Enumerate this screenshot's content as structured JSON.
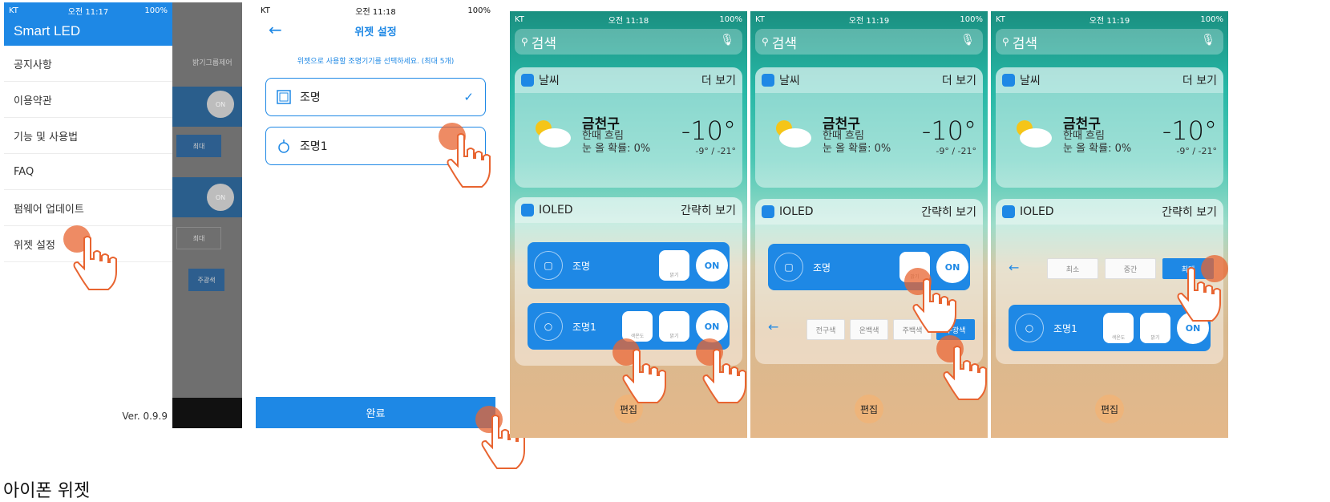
{
  "status_bar": {
    "p1": {
      "carrier": "KT",
      "time": "오전 11:17",
      "battery": "100%"
    },
    "p2": {
      "carrier": "KT",
      "time": "오전 11:18",
      "battery": "100%"
    },
    "p3": {
      "carrier": "KT",
      "time": "오전 11:18",
      "battery": "100%"
    },
    "p4": {
      "carrier": "KT",
      "time": "오전 11:19",
      "battery": "100%"
    },
    "p5": {
      "carrier": "KT",
      "time": "오전 11:19",
      "battery": "100%"
    }
  },
  "drawer": {
    "title": "Smart LED",
    "items": [
      "공지사항",
      "이용약관",
      "기능 및 사용법",
      "FAQ",
      "펌웨어 업데이트",
      "위젯 설정"
    ],
    "version": "Ver. 0.9.9",
    "bg_labels": {
      "top": "밝기그룹제어",
      "on1": "ON",
      "max": "최대",
      "on2": "ON",
      "max2": "최대",
      "main": "주광색"
    }
  },
  "widget_settings": {
    "back": "←",
    "title": "위젯 설정",
    "hint": "위젯으로 사용할 조명기기를 선택하세요. (최대 5개)",
    "devices": [
      {
        "name": "조명",
        "checked": true,
        "icon": "square-lamp-icon"
      },
      {
        "name": "조명1",
        "checked": false,
        "icon": "bulb-icon"
      }
    ],
    "check_mark": "✓",
    "done": "완료"
  },
  "widget": {
    "search": "검색",
    "weather_title": "날씨",
    "more": "더 보기",
    "city": "금천구",
    "condition": "한때 흐림",
    "snow": "눈 올 확률: 0%",
    "temp": "-10°",
    "range": "-9° / -21°",
    "app_title": "IOLED",
    "collapse": "간략히 보기",
    "edit": "편집",
    "light1": "조명",
    "light2": "조명1",
    "on": "ON",
    "brightness": "밝기",
    "color_temp": "색온도",
    "color_opts": [
      "전구색",
      "온백색",
      "주백색",
      "주광색"
    ],
    "level_opts": [
      "최소",
      "중간",
      "최대"
    ],
    "back": "←"
  },
  "caption": "아이폰 위젯",
  "colors": {
    "accent": "#1e88e5",
    "tap": "#e86430"
  }
}
